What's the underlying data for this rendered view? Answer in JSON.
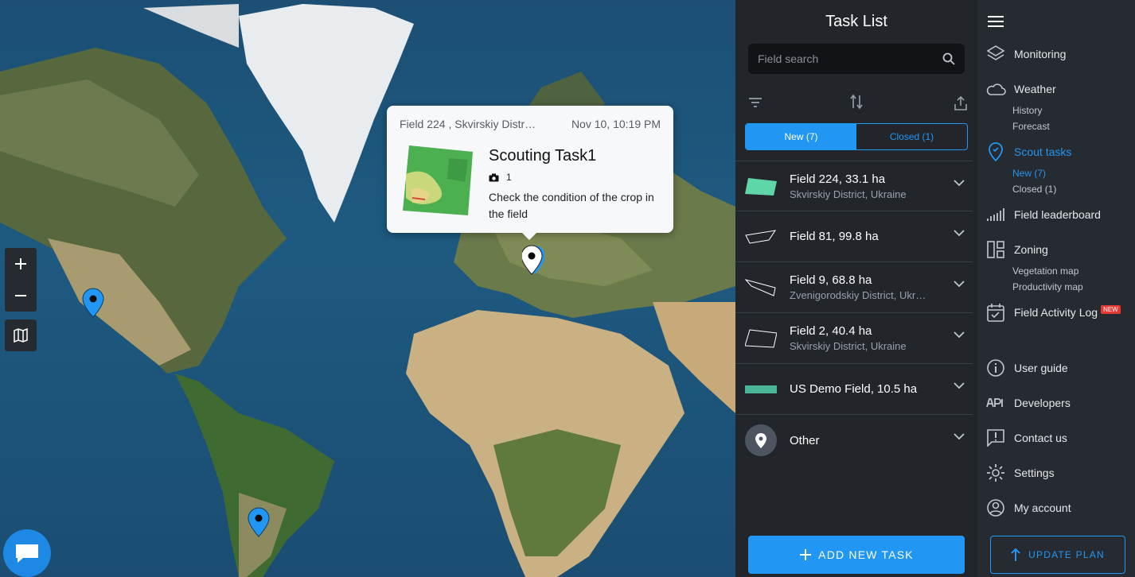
{
  "map": {
    "zoom_in": "+",
    "zoom_out": "−",
    "popup": {
      "field": "Field 224 , Skvirskiy Distr…",
      "date": "Nov 10, 10:19 PM",
      "title": "Scouting Task1",
      "photo_count": "1",
      "description": "Check the condition of the crop in the field"
    }
  },
  "task_panel": {
    "title": "Task List",
    "search_placeholder": "Field search",
    "tabs": [
      {
        "label": "New (7)",
        "active": true
      },
      {
        "label": "Closed (1)",
        "active": false
      }
    ],
    "items": [
      {
        "title": "Field 224, 33.1 ha",
        "subtitle": "Skvirskiy District, Ukraine"
      },
      {
        "title": "Field 81, 99.8 ha",
        "subtitle": ""
      },
      {
        "title": "Field 9, 68.8 ha",
        "subtitle": "Zvenigorodskiy District, Ukr…"
      },
      {
        "title": "Field 2, 40.4 ha",
        "subtitle": "Skvirskiy District, Ukraine"
      },
      {
        "title": "US Demo Field, 10.5 ha",
        "subtitle": ""
      },
      {
        "title": "Other",
        "subtitle": ""
      }
    ],
    "add_button": "ADD NEW TASK"
  },
  "nav": {
    "monitoring": "Monitoring",
    "weather": "Weather",
    "history": "History",
    "forecast": "Forecast",
    "scout_tasks": "Scout tasks",
    "new": "New (7)",
    "closed": "Closed (1)",
    "field_leaderboard": "Field leaderboard",
    "zoning": "Zoning",
    "vegetation_map": "Vegetation map",
    "productivity_map": "Productivity map",
    "field_activity_log": "Field Activity Log",
    "new_badge": "NEW",
    "user_guide": "User guide",
    "developers": "Developers",
    "contact_us": "Contact us",
    "settings": "Settings",
    "my_account": "My account",
    "update_plan": "UPDATE PLAN"
  },
  "colors": {
    "accent": "#2196f3",
    "panel_bg": "#22262b",
    "nav_bg": "#262b31",
    "field_fill": "#5fd6a8"
  }
}
